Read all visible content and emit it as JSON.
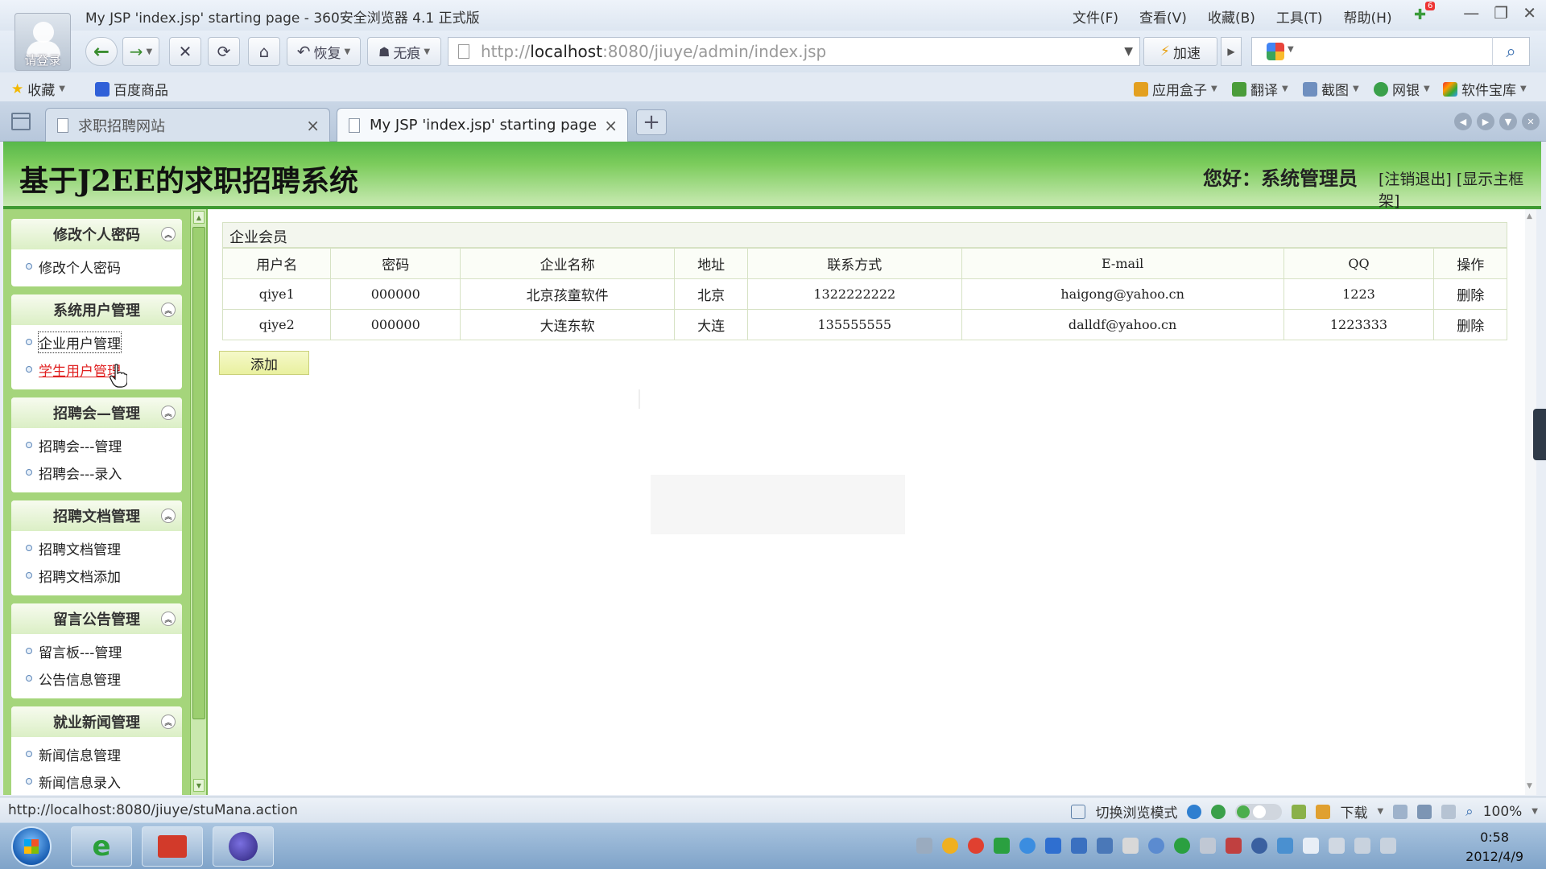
{
  "browser": {
    "window_title": "My JSP 'index.jsp' starting page - 360安全浏览器 4.1 正式版",
    "login_label": "请登录",
    "menus": [
      "文件(F)",
      "查看(V)",
      "收藏(B)",
      "工具(T)",
      "帮助(H)"
    ],
    "notification_count": "6",
    "restore_label": "恢复",
    "trace_label": "无痕",
    "address": {
      "scheme": "http://",
      "host": "localhost",
      "rest": ":8080/jiuye/admin/index.jsp"
    },
    "speed_label": "加速",
    "bookmarks": [
      "收藏",
      "百度商品"
    ],
    "tools": [
      "应用盒子",
      "翻译",
      "截图",
      "网银",
      "软件宝库"
    ],
    "tabs": [
      {
        "label": "求职招聘网站",
        "active": false
      },
      {
        "label": "My JSP 'index.jsp' starting page",
        "active": true
      }
    ]
  },
  "header": {
    "title": "基于J2EE的求职招聘系统",
    "greeting": "您好：系统管理员",
    "links": "[注销退出] [显示主框架]"
  },
  "sidebar": {
    "sections": [
      {
        "title": "修改个人密码",
        "items": [
          "修改个人密码"
        ]
      },
      {
        "title": "系统用户管理",
        "items": [
          "企业用户管理",
          "学生用户管理"
        ]
      },
      {
        "title": "招聘会—管理",
        "items": [
          "招聘会---管理",
          "招聘会---录入"
        ]
      },
      {
        "title": "招聘文档管理",
        "items": [
          "招聘文档管理",
          "招聘文档添加"
        ]
      },
      {
        "title": "留言公告管理",
        "items": [
          "留言板---管理",
          "公告信息管理"
        ]
      },
      {
        "title": "就业新闻管理",
        "items": [
          "新闻信息管理",
          "新闻信息录入"
        ]
      }
    ]
  },
  "main": {
    "panel_title": "企业会员",
    "columns": [
      "用户名",
      "密码",
      "企业名称",
      "地址",
      "联系方式",
      "E-mail",
      "QQ",
      "操作"
    ],
    "rows": [
      [
        "qiye1",
        "000000",
        "北京孩童软件",
        "北京",
        "1322222222",
        "haigong@yahoo.cn",
        "1223",
        "删除"
      ],
      [
        "qiye2",
        "000000",
        "大连东软",
        "大连",
        "135555555",
        "dalldf@yahoo.cn",
        "1223333",
        "删除"
      ]
    ],
    "add_label": "添加"
  },
  "status": {
    "url": "http://localhost:8080/jiuye/stuMana.action",
    "mode_label": "切换浏览模式",
    "download_label": "下载",
    "zoom": "100%"
  },
  "taskbar": {
    "time": "0:58",
    "date": "2012/4/9"
  }
}
